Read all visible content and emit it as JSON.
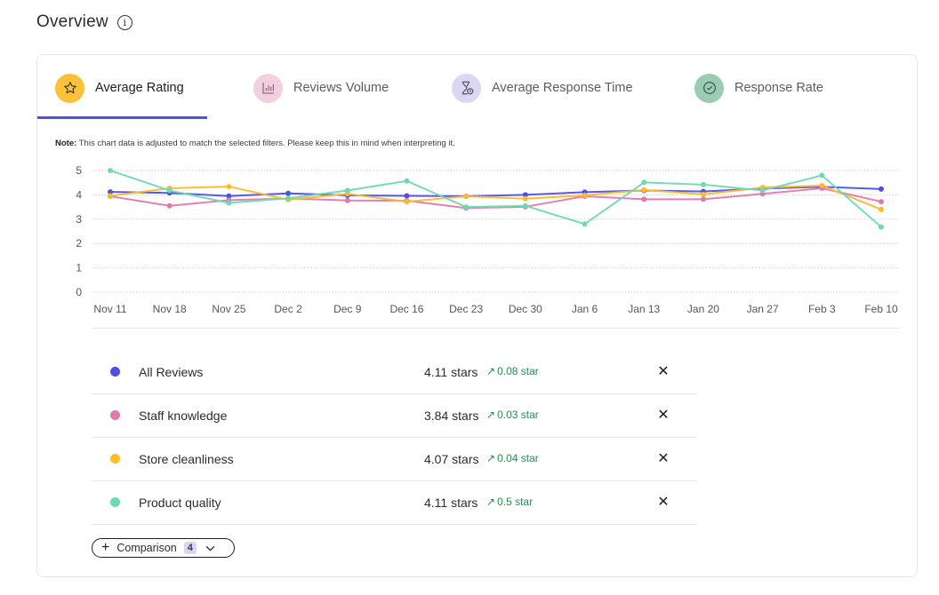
{
  "header": {
    "title": "Overview",
    "info_icon": "info-circle-icon"
  },
  "tabs": [
    {
      "label": "Average Rating",
      "icon": "star-icon",
      "icon_bg": "#fcc13b",
      "active": true
    },
    {
      "label": "Reviews Volume",
      "icon": "bar-chart-icon",
      "icon_bg": "#f3cfe0",
      "active": false
    },
    {
      "label": "Average Response Time",
      "icon": "hourglass-clock-icon",
      "icon_bg": "#ddd6f3",
      "active": false
    },
    {
      "label": "Response Rate",
      "icon": "check-circle-icon",
      "icon_bg": "#99cdb1",
      "active": false
    }
  ],
  "note": {
    "prefix": "Note:",
    "text": " This chart data is adjusted to match the selected filters. Please keep this in mind when interpreting it."
  },
  "chart_data": {
    "type": "line",
    "title": "",
    "xlabel": "",
    "ylabel": "",
    "ylim": [
      0,
      5
    ],
    "yticks": [
      0,
      1,
      2,
      3,
      4,
      5
    ],
    "grid": true,
    "legend_position": "bottom",
    "x": [
      "Nov 11",
      "Nov 18",
      "Nov 25",
      "Dec 2",
      "Dec 9",
      "Dec 16",
      "Dec 23",
      "Dec 30",
      "Jan 6",
      "Jan 13",
      "Jan 20",
      "Jan 27",
      "Feb 3",
      "Feb 10"
    ],
    "series": [
      {
        "name": "All Reviews",
        "color": "#4f4fe8",
        "values": [
          4.12,
          4.08,
          3.95,
          4.06,
          3.98,
          3.96,
          3.94,
          4.0,
          4.11,
          4.18,
          4.14,
          4.26,
          4.33,
          4.24
        ]
      },
      {
        "name": "Staff knowledge",
        "color": "#e079b0",
        "values": [
          3.94,
          3.55,
          3.78,
          3.85,
          3.77,
          3.76,
          3.46,
          3.51,
          3.94,
          3.82,
          3.82,
          4.04,
          4.27,
          3.72
        ]
      },
      {
        "name": "Store cleanliness",
        "color": "#fbbb2b",
        "values": [
          3.96,
          4.27,
          4.34,
          3.8,
          4.04,
          3.72,
          3.94,
          3.84,
          3.98,
          4.2,
          4.02,
          4.3,
          4.38,
          3.4
        ]
      },
      {
        "name": "Product quality",
        "color": "#6fd9b5",
        "values": [
          5.0,
          4.18,
          3.67,
          3.86,
          4.18,
          4.57,
          3.5,
          3.55,
          2.8,
          4.51,
          4.42,
          4.18,
          4.8,
          2.68
        ]
      }
    ]
  },
  "legend": [
    {
      "name": "All Reviews",
      "color": "#4f4fe8",
      "value": "4.11 stars",
      "delta": "0.08 star",
      "delta_icon": "↗"
    },
    {
      "name": "Staff knowledge",
      "color": "#e079b0",
      "value": "3.84 stars",
      "delta": "0.03 star",
      "delta_icon": "↗"
    },
    {
      "name": "Store cleanliness",
      "color": "#fbbb2b",
      "value": "4.07 stars",
      "delta": "0.04 star",
      "delta_icon": "↗"
    },
    {
      "name": "Product quality",
      "color": "#6fd9b5",
      "value": "4.11 stars",
      "delta": "0.5 star",
      "delta_icon": "↗"
    }
  ],
  "remove_symbol": "✕",
  "comparison": {
    "plus": "+",
    "label": "Comparison",
    "count": "4"
  }
}
